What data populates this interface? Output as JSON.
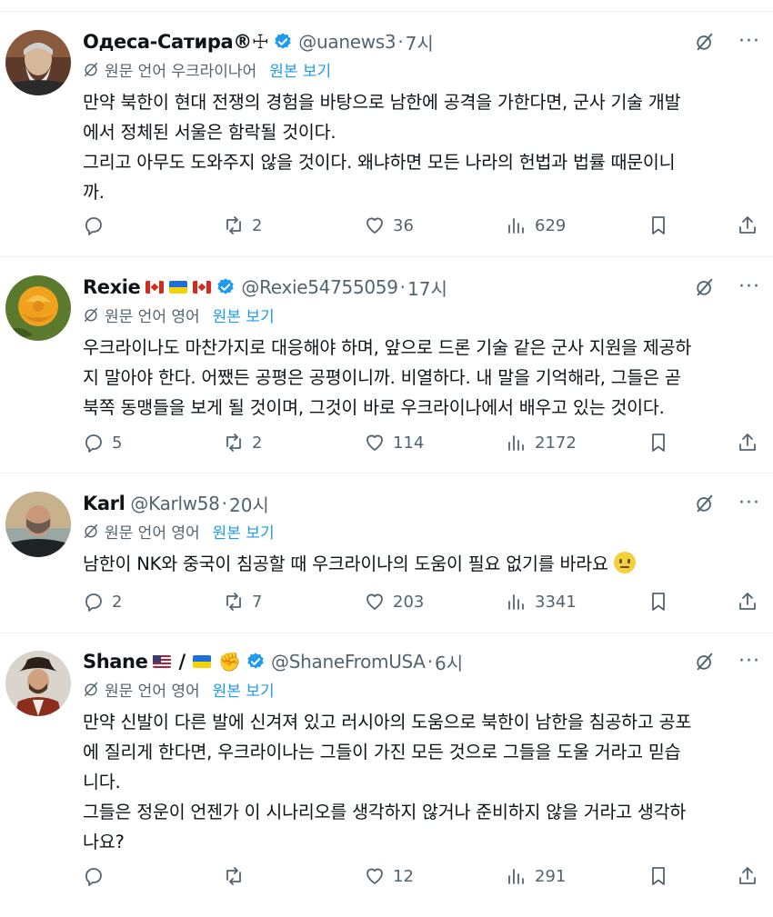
{
  "colors": {
    "text": "#0f1419",
    "secondary": "#536471",
    "link": "#1d9bf0",
    "verified": "#1d9bf0",
    "divider": "#eff3f4"
  },
  "tweets": [
    {
      "name": "Одеса-Сатира®☩",
      "handle": "@uanews3",
      "dot": "·",
      "time": "7시",
      "translate_label": "원문 언어 우크라이나어",
      "show_original": "원본 보기",
      "lines": [
        "만약 북한이 현대 전쟁의 경험을 바탕으로 남한에 공격을 가한다면, 군사 기술 개발",
        "에서 정체된 서울은 함락될 것이다.",
        "그리고 아무도 도와주지 않을 것이다. 왜냐하면 모든 나라의 헌법과 법률 때문이니",
        "까."
      ],
      "replies": "",
      "retweets": "2",
      "likes": "36",
      "views": "629"
    },
    {
      "name": "Rexie",
      "handle": "@Rexie54755059",
      "dot": "·",
      "time": "17시",
      "translate_label": "원문 언어 영어",
      "show_original": "원본 보기",
      "lines": [
        "우크라이나도 마찬가지로 대응해야 하며, 앞으로 드론 기술 같은 군사 지원을 제공하",
        "지 말아야 한다. 어쨌든 공평은 공평이니까. 비열하다. 내 말을 기억해라, 그들은 곧",
        "북쪽 동맹들을 보게 될 것이며, 그것이 바로 우크라이나에서 배우고 있는 것이다."
      ],
      "replies": "5",
      "retweets": "2",
      "likes": "114",
      "views": "2172"
    },
    {
      "name": "Karl",
      "handle": "@Karlw58",
      "dot": "·",
      "time": "20시",
      "translate_label": "원문 언어 영어",
      "show_original": "원본 보기",
      "lines": [
        "남한이 NK와 중국이 침공할 때 우크라이나의 도움이 필요 없기를 바라요"
      ],
      "replies": "2",
      "retweets": "7",
      "likes": "203",
      "views": "3341"
    },
    {
      "name": "Shane",
      "handle": "@ShaneFromUSA",
      "dot": "·",
      "time": "6시",
      "translate_label": "원문 언어 영어",
      "show_original": "원본 보기",
      "lines": [
        "만약 신발이 다른 발에 신겨져 있고 러시아의 도움으로 북한이 남한을 침공하고 공포",
        "에 질리게 한다면, 우크라이나는 그들이 가진 모든 것으로 그들을 도울 거라고 믿습",
        "니다.",
        "그들은 정운이 언젠가 이 시나리오를 생각하지 않거나 준비하지 않을 거라고 생각하",
        "나요?"
      ],
      "replies": "",
      "retweets": "",
      "likes": "12",
      "views": "291"
    }
  ],
  "icons": {
    "verified": "verified-badge-icon",
    "grok": "grok-slash-icon",
    "more": "more-dots-icon",
    "translate": "translate-icon",
    "reply": "reply-icon",
    "retweet": "retweet-icon",
    "like": "heart-icon",
    "views": "views-chart-icon",
    "bookmark": "bookmark-icon",
    "share": "share-icon"
  },
  "more_glyph": "···",
  "slash": "/"
}
